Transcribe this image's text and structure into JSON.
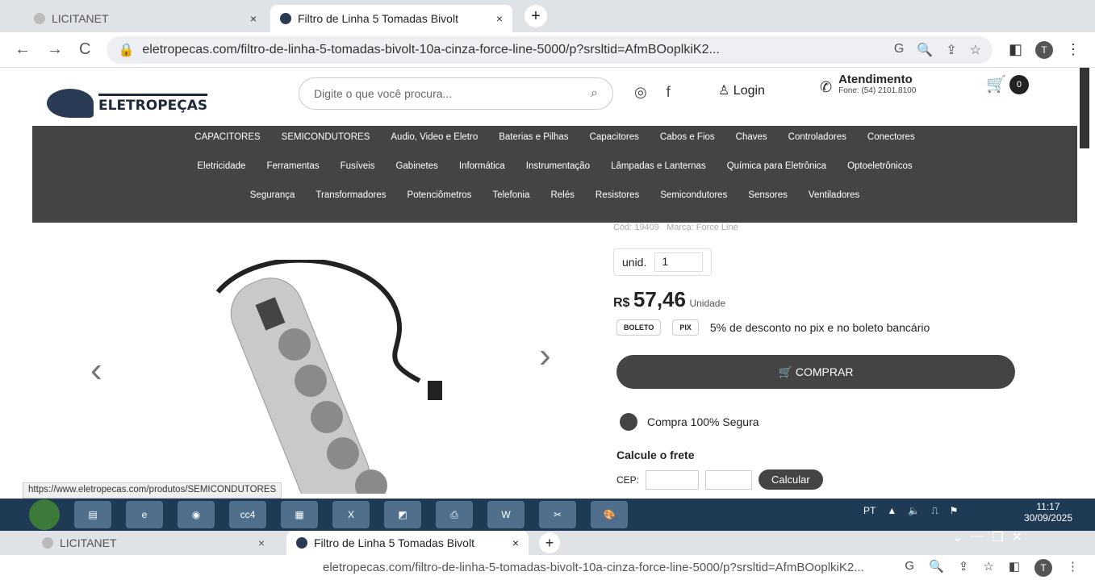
{
  "browser": {
    "tabs": [
      {
        "label": "LICITANET",
        "close": "×"
      },
      {
        "label": "Filtro de Linha 5 Tomadas Bivolt",
        "close": "×"
      }
    ],
    "new_tab": "+",
    "url": "eletropecas.com/filtro-de-linha-5-tomadas-bivolt-10a-cinza-force-line-5000/p?srsltid=AfmBOoplkiK2...",
    "avatar": "T"
  },
  "site": {
    "logo_text": "ELETROPEÇAS",
    "search_placeholder": "Digite o que você procura...",
    "login": "Login",
    "atendimento": "Atendimento",
    "fone": "Fone: (54) 2101.8100",
    "cart_count": "0"
  },
  "categories": {
    "row1": [
      "CAPACITORES",
      "SEMICONDUTORES",
      "Audio, Video e Eletro",
      "Baterias e Pilhas",
      "Capacitores",
      "Cabos e Fios",
      "Chaves",
      "Controladores",
      "Conectores"
    ],
    "row2": [
      "Eletricidade",
      "Ferramentas",
      "Fusíveis",
      "Gabinetes",
      "Informática",
      "Instrumentação",
      "Lâmpadas e Lanternas",
      "Química para Eletrônica",
      "Optoeletrônicos"
    ],
    "row3": [
      "Segurança",
      "Transformadores",
      "Potenciômetros",
      "Telefonia",
      "Relés",
      "Resistores",
      "Semicondutores",
      "Sensores",
      "Ventiladores"
    ]
  },
  "product": {
    "cod": "Cód: 19409",
    "marca": "Marca: Force Line",
    "qty_label": "unid.",
    "qty": "1",
    "currency": "R$",
    "price": "57,46",
    "unit": "Unidade",
    "boleto": "BOLETO",
    "pix": "PIX",
    "discount": "5% de desconto no pix e no boleto bancário",
    "buy": "COMPRAR",
    "secure": "Compra 100% Segura",
    "frete": "Calcule o frete",
    "cep": "CEP:",
    "calc": "Calcular"
  },
  "status_url": "https://www.eletropecas.com/produtos/SEMICONDUTORES",
  "taskbar": {
    "lang": "PT",
    "time": "11:17",
    "date": "30/09/2025"
  }
}
